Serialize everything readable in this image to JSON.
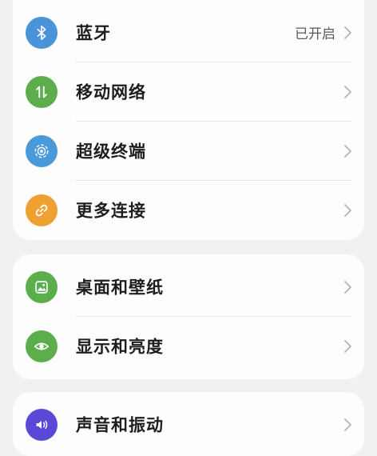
{
  "settings_groups": [
    {
      "items": [
        {
          "label": "蓝牙",
          "value": "已开启",
          "icon": "bluetooth-icon",
          "color": "#4a93d9"
        },
        {
          "label": "移动网络",
          "value": "",
          "icon": "mobile-network-icon",
          "color": "#5cae4c"
        },
        {
          "label": "超级终端",
          "value": "",
          "icon": "super-device-icon",
          "color": "#4a99d9"
        },
        {
          "label": "更多连接",
          "value": "",
          "icon": "link-icon",
          "color": "#efa030"
        }
      ]
    },
    {
      "items": [
        {
          "label": "桌面和壁纸",
          "value": "",
          "icon": "wallpaper-icon",
          "color": "#5cae4c"
        },
        {
          "label": "显示和亮度",
          "value": "",
          "icon": "eye-icon",
          "color": "#5cae4c"
        }
      ]
    },
    {
      "items": [
        {
          "label": "声音和振动",
          "value": "",
          "icon": "sound-icon",
          "color": "#5a49d6"
        }
      ]
    }
  ]
}
